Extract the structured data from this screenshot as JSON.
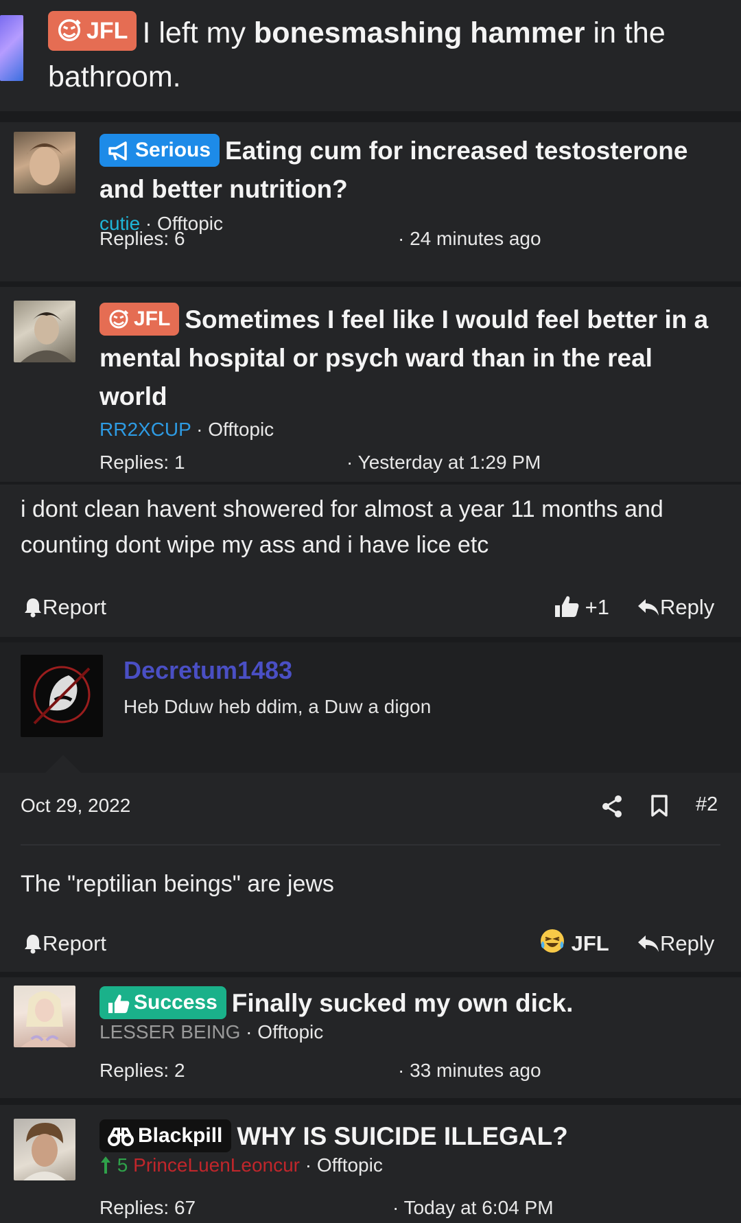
{
  "top_thread": {
    "prefix": "JFL",
    "title_pre": "I left my ",
    "title_bold": "bonesmashing hammer",
    "title_post": " in the bathroom."
  },
  "threads": [
    {
      "prefix": "Serious",
      "title": "Eating cum for increased testosterone and better nutrition?",
      "author": "cutie",
      "author_color": "#1fb6d8",
      "forum": "Offtopic",
      "replies": "Replies: 6",
      "time": "24 minutes ago"
    },
    {
      "prefix": "JFL",
      "title": "Sometimes I feel like I would feel better in a mental hospital or psych ward than in the real world",
      "author": "RR2XCUP",
      "author_color": "#2e9be3",
      "forum": "Offtopic",
      "replies": "Replies: 1",
      "time": "Yesterday at 1:29 PM"
    },
    {
      "prefix": "Success",
      "title": "Finally sucked my own dick.",
      "author": "LESSER BEING",
      "author_color": "#9a9a9a",
      "forum": "Offtopic",
      "replies": "Replies: 2",
      "time": "33 minutes ago"
    },
    {
      "prefix": "Blackpill",
      "title": "WHY IS SUICIDE ILLEGAL?",
      "score": "5",
      "author": "PrinceLuenLeoncur",
      "author_color": "#c0262b",
      "forum": "Offtopic",
      "replies": "Replies: 67",
      "time": "Today at 6:04 PM"
    }
  ],
  "post1": {
    "text": "i dont clean havent showered for almost a year 11 months and counting dont wipe my ass and i have lice etc",
    "report_label": "Report",
    "reaction": "+1",
    "reply_label": "Reply"
  },
  "post2": {
    "username": "Decretum1483",
    "signature": "Heb Dduw heb ddim, a Duw a digon",
    "date": "Oct 29, 2022",
    "post_number": "#2",
    "text": "The \"reptilian beings\" are jews",
    "report_label": "Report",
    "reaction": "JFL",
    "reply_label": "Reply"
  },
  "colors": {
    "background": "#1a1b1d",
    "card": "#242527",
    "jfl": "#e56d53",
    "serious": "#1d8be8",
    "success": "#1ab18a",
    "username": "#4a4fc4",
    "score_up": "#2fa14a"
  },
  "icons": [
    "jfl-face-icon",
    "megaphone-icon",
    "thumbs-up-icon",
    "binoculars-icon",
    "bell-icon",
    "reply-arrow-icon",
    "share-icon",
    "bookmark-icon",
    "laughing-emoji-icon",
    "arrow-up-icon"
  ]
}
